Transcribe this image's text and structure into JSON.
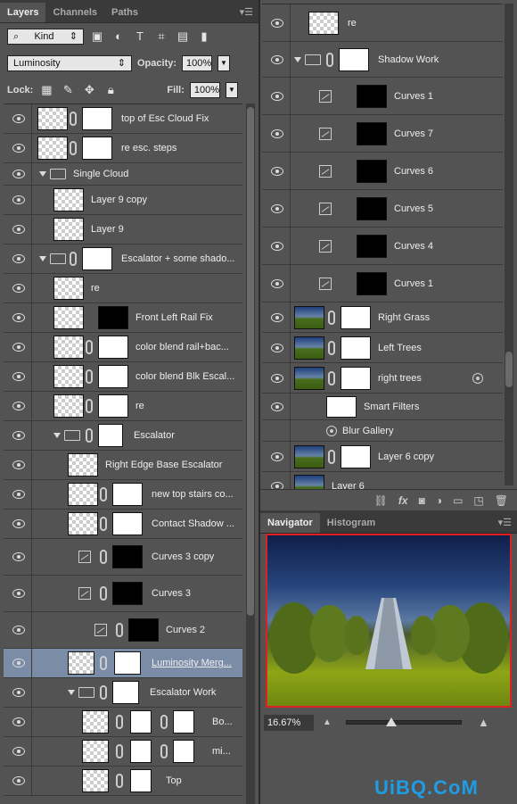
{
  "layers_panel": {
    "tabs": [
      "Layers",
      "Channels",
      "Paths"
    ],
    "kind_label": "Kind",
    "blend_mode": "Luminosity",
    "opacity_label": "Opacity:",
    "opacity_value": "100%",
    "lock_label": "Lock:",
    "fill_label": "Fill:",
    "fill_value": "100%",
    "rows": [
      {
        "name": "top of Esc Cloud Fix"
      },
      {
        "name": "re esc. steps"
      },
      {
        "name": "Single Cloud"
      },
      {
        "name": "Layer 9 copy"
      },
      {
        "name": "Layer 9"
      },
      {
        "name": "Escalator + some shado..."
      },
      {
        "name": "re"
      },
      {
        "name": "Front Left Rail Fix"
      },
      {
        "name": "color blend rail+bac..."
      },
      {
        "name": "color blend Blk Escal..."
      },
      {
        "name": "re"
      },
      {
        "name": "Escalator"
      },
      {
        "name": "Right Edge Base Escalator"
      },
      {
        "name": "new top stairs co..."
      },
      {
        "name": "Contact Shadow ..."
      },
      {
        "name": "Curves 3 copy"
      },
      {
        "name": "Curves 3"
      },
      {
        "name": "Curves 2"
      },
      {
        "name": "Luminosity Merg..."
      },
      {
        "name": "Escalator Work"
      },
      {
        "name": "Bo..."
      },
      {
        "name": "mi..."
      },
      {
        "name": "Top"
      }
    ]
  },
  "right_layers": {
    "rows": [
      {
        "name": "re"
      },
      {
        "name": "Shadow Work"
      },
      {
        "name": "Curves 1"
      },
      {
        "name": "Curves 7"
      },
      {
        "name": "Curves 6"
      },
      {
        "name": "Curves 5"
      },
      {
        "name": "Curves 4"
      },
      {
        "name": "Curves 1"
      },
      {
        "name": "Right Grass"
      },
      {
        "name": "Left Trees"
      },
      {
        "name": "right trees"
      },
      {
        "name": "Smart Filters"
      },
      {
        "name": "Blur Gallery"
      },
      {
        "name": "Layer 6 copy"
      },
      {
        "name": "Layer 6"
      }
    ],
    "footer_icons": [
      "link-icon",
      "fx-icon",
      "mask-icon",
      "adjustment-icon",
      "group-icon",
      "new-layer-icon",
      "trash-icon"
    ],
    "fx_label": "fx"
  },
  "navigator": {
    "tabs": [
      "Navigator",
      "Histogram"
    ],
    "zoom": "16.67%"
  },
  "watermark": "UiBQ.CoM",
  "colors": {
    "selected_row": "#7b8ca6",
    "navigator_frame": "#e02020",
    "watermark": "#1e9de6"
  }
}
